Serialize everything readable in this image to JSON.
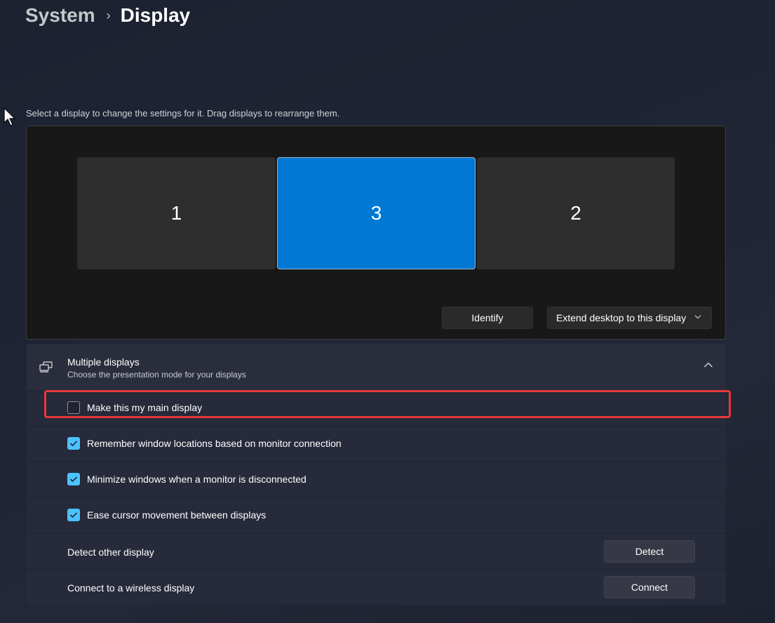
{
  "breadcrumb": {
    "parent": "System",
    "separator": "›",
    "current": "Display"
  },
  "instruction": "Select a display to change the settings for it. Drag displays to rearrange them.",
  "monitors": [
    {
      "label": "1",
      "selected": false
    },
    {
      "label": "3",
      "selected": true
    },
    {
      "label": "2",
      "selected": false
    }
  ],
  "arrange_actions": {
    "identify_label": "Identify",
    "mode_dropdown_value": "Extend desktop to this display"
  },
  "multiple_displays": {
    "title": "Multiple displays",
    "subtitle": "Choose the presentation mode for your displays",
    "expanded": true,
    "options": [
      {
        "label": "Make this my main display",
        "checked": false
      },
      {
        "label": "Remember window locations based on monitor connection",
        "checked": true
      },
      {
        "label": "Minimize windows when a monitor is disconnected",
        "checked": true
      },
      {
        "label": "Ease cursor movement between displays",
        "checked": true
      }
    ],
    "detect": {
      "label": "Detect other display",
      "button": "Detect"
    },
    "connect": {
      "label": "Connect to a wireless display",
      "button": "Connect"
    }
  },
  "colors": {
    "accent": "#0078d4",
    "checkbox_checked": "#4cc2ff",
    "highlight": "#e5393a"
  }
}
